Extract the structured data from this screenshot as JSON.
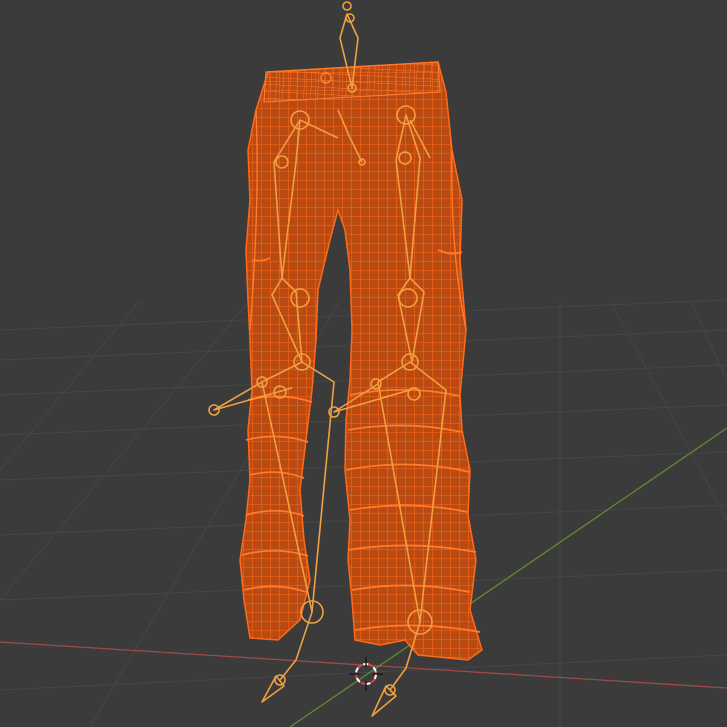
{
  "viewport": {
    "background": "#3b3b3b",
    "grid_color": "#464646",
    "x_axis_color": "#9b4a4a",
    "y_axis_color": "#5f8c2e"
  },
  "mesh": {
    "object": "cargo-pants-wireframe",
    "wire_color": "#ff6a1a",
    "fill_color": "#b84a12"
  },
  "armature": {
    "bone_color": "#f0a040",
    "selected": true
  },
  "cursor": {
    "icon": "3d-cursor-icon",
    "ring_colors": [
      "#e04040",
      "#ffffff"
    ]
  }
}
